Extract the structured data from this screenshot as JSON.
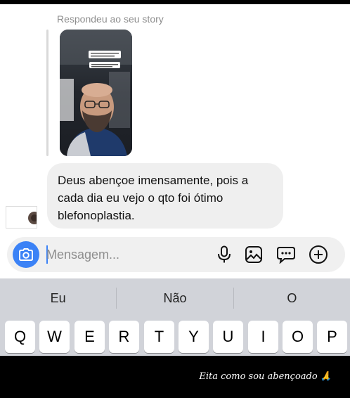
{
  "reply": {
    "label": "Respondeu ao seu story"
  },
  "story": {
    "text_top": "Beleza, é o que não conseguem ver na foto...",
    "text_bottom": "Nós, o retorno, nada de ruim"
  },
  "message": {
    "text": "Deus abençoe imensamente,  pois a\ncada dia  eu vejo o qto foi ótimo\nblefonoplastia."
  },
  "composer": {
    "placeholder": "Mensagem..."
  },
  "keyboard": {
    "suggestions": [
      "Eu",
      "Não",
      "O"
    ],
    "row1": [
      "Q",
      "W",
      "E",
      "R",
      "T",
      "Y",
      "U",
      "I",
      "O",
      "P"
    ]
  },
  "caption": {
    "text": "Eita como sou abençoado 🙏"
  },
  "colors": {
    "accent": "#3b82f6",
    "bubble": "#efefef",
    "keyboard": "#d1d3d9"
  }
}
